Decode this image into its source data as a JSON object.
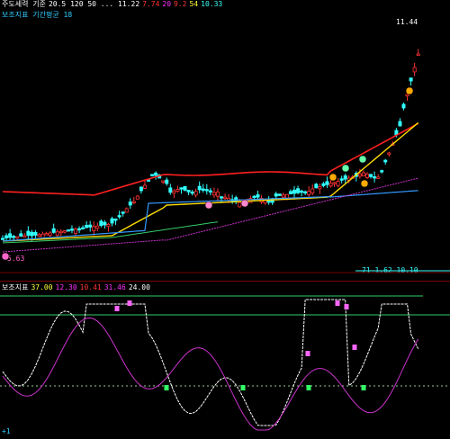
{
  "main": {
    "legend1": [
      {
        "text": "주도세력 기준",
        "color": "#ffffff"
      },
      {
        "text": "20.5  120  50  ... 11.22",
        "color": "#ffffff"
      },
      {
        "text": "7.74",
        "color": "#ff3333"
      },
      {
        "text": "20",
        "color": "#ff33ff"
      },
      {
        "text": "9.2",
        "color": "#ff3333"
      },
      {
        "text": "54",
        "color": "#ffff33"
      },
      {
        "text": "10.33",
        "color": "#33ffff"
      }
    ],
    "legend2": [
      {
        "text": "보조지표 기간평균 18",
        "color": "#33ccff"
      }
    ],
    "price_tag": "11.44",
    "low_price_tag": "5.63",
    "right_info": "71 1.62  10.10"
  },
  "sub": {
    "legend": [
      {
        "text": "보조지표",
        "color": "#ffffff"
      },
      {
        "text": "37.00",
        "color": "#ffff33"
      },
      {
        "text": "12.30",
        "color": "#ff33ff"
      },
      {
        "text": "10.41",
        "color": "#ff3333"
      },
      {
        "text": "31.46",
        "color": "#ff33ff"
      },
      {
        "text": "24.00",
        "color": "#ffffff"
      }
    ],
    "corner_label": "+1"
  },
  "colors": {
    "up": "#ff3333",
    "down": "#33ffff",
    "ma_red": "#ff2020",
    "ma_yellow": "#ffdd00",
    "ma_blue": "#3399ff",
    "ma_purple": "#cc33cc",
    "ma_green": "#33cc66",
    "osc_white": "#ffffff",
    "osc_magenta": "#cc33cc",
    "level_green": "#33cc66",
    "baseline": "#99cc99"
  }
}
